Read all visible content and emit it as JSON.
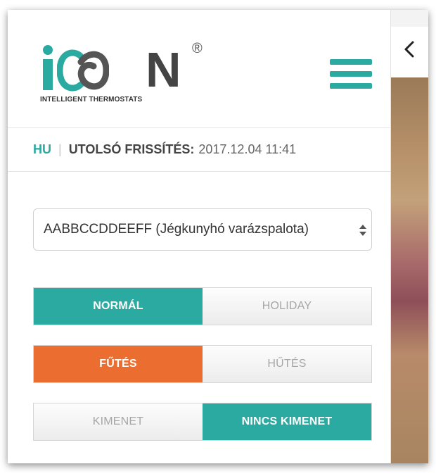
{
  "brand": {
    "logo_letters": "ICON",
    "registered": "®",
    "tagline": "INTELLIGENT THERMOSTATS",
    "accent_color": "#2aaaa0",
    "orange_color": "#eb6d30"
  },
  "header": {
    "menu_icon": "hamburger-menu-icon",
    "close_icon": "chevron-left-icon"
  },
  "info": {
    "language": "HU",
    "separator": "|",
    "last_update_label": "UTOLSÓ FRISSÍTÉS:",
    "last_update_value": "2017.12.04 11:41"
  },
  "device_select": {
    "selected": "AABBCCDDEEFF (Jégkunyhó varázspalota)"
  },
  "mode_toggle": {
    "options": [
      "NORMÁL",
      "HOLIDAY"
    ],
    "selected": "NORMÁL"
  },
  "heat_cool_toggle": {
    "options": [
      "FŰTÉS",
      "HŰTÉS"
    ],
    "selected": "FŰTÉS"
  },
  "output_toggle": {
    "options": [
      "KIMENET",
      "NINCS KIMENET"
    ],
    "selected": "NINCS KIMENET"
  }
}
